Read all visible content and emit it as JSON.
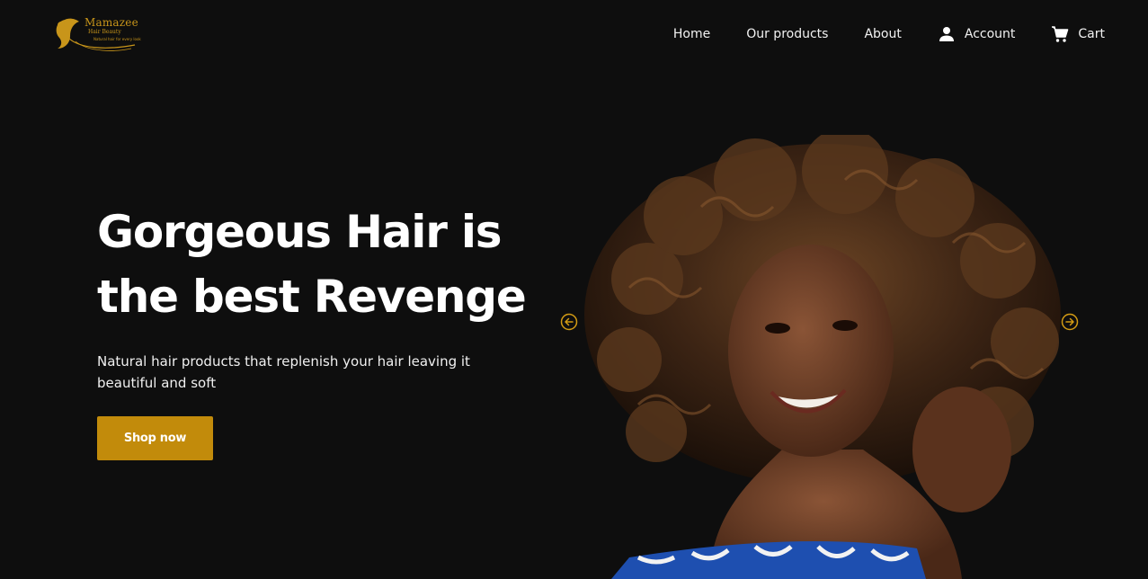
{
  "brand": {
    "logo_name": "Mamazee",
    "logo_sub": "Hair Beauty",
    "logo_tagline": "Natural hair for every look",
    "accent_color": "#c28b0b"
  },
  "nav": {
    "items": [
      {
        "label": "Home",
        "icon": null
      },
      {
        "label": "Our products",
        "icon": null
      },
      {
        "label": "About",
        "icon": null
      },
      {
        "label": "Account",
        "icon": "user-icon"
      },
      {
        "label": "Cart",
        "icon": "cart-icon"
      }
    ]
  },
  "hero": {
    "title_line1": "Gorgeous Hair is",
    "title_line2": "the best Revenge",
    "subtitle": "Natural hair products that replenish your hair leaving it beautiful and soft",
    "cta_label": "Shop now"
  },
  "carousel": {
    "prev_icon": "arrow-left-circle-icon",
    "next_icon": "arrow-right-circle-icon",
    "image": "woman-with-curly-hair-photo"
  }
}
